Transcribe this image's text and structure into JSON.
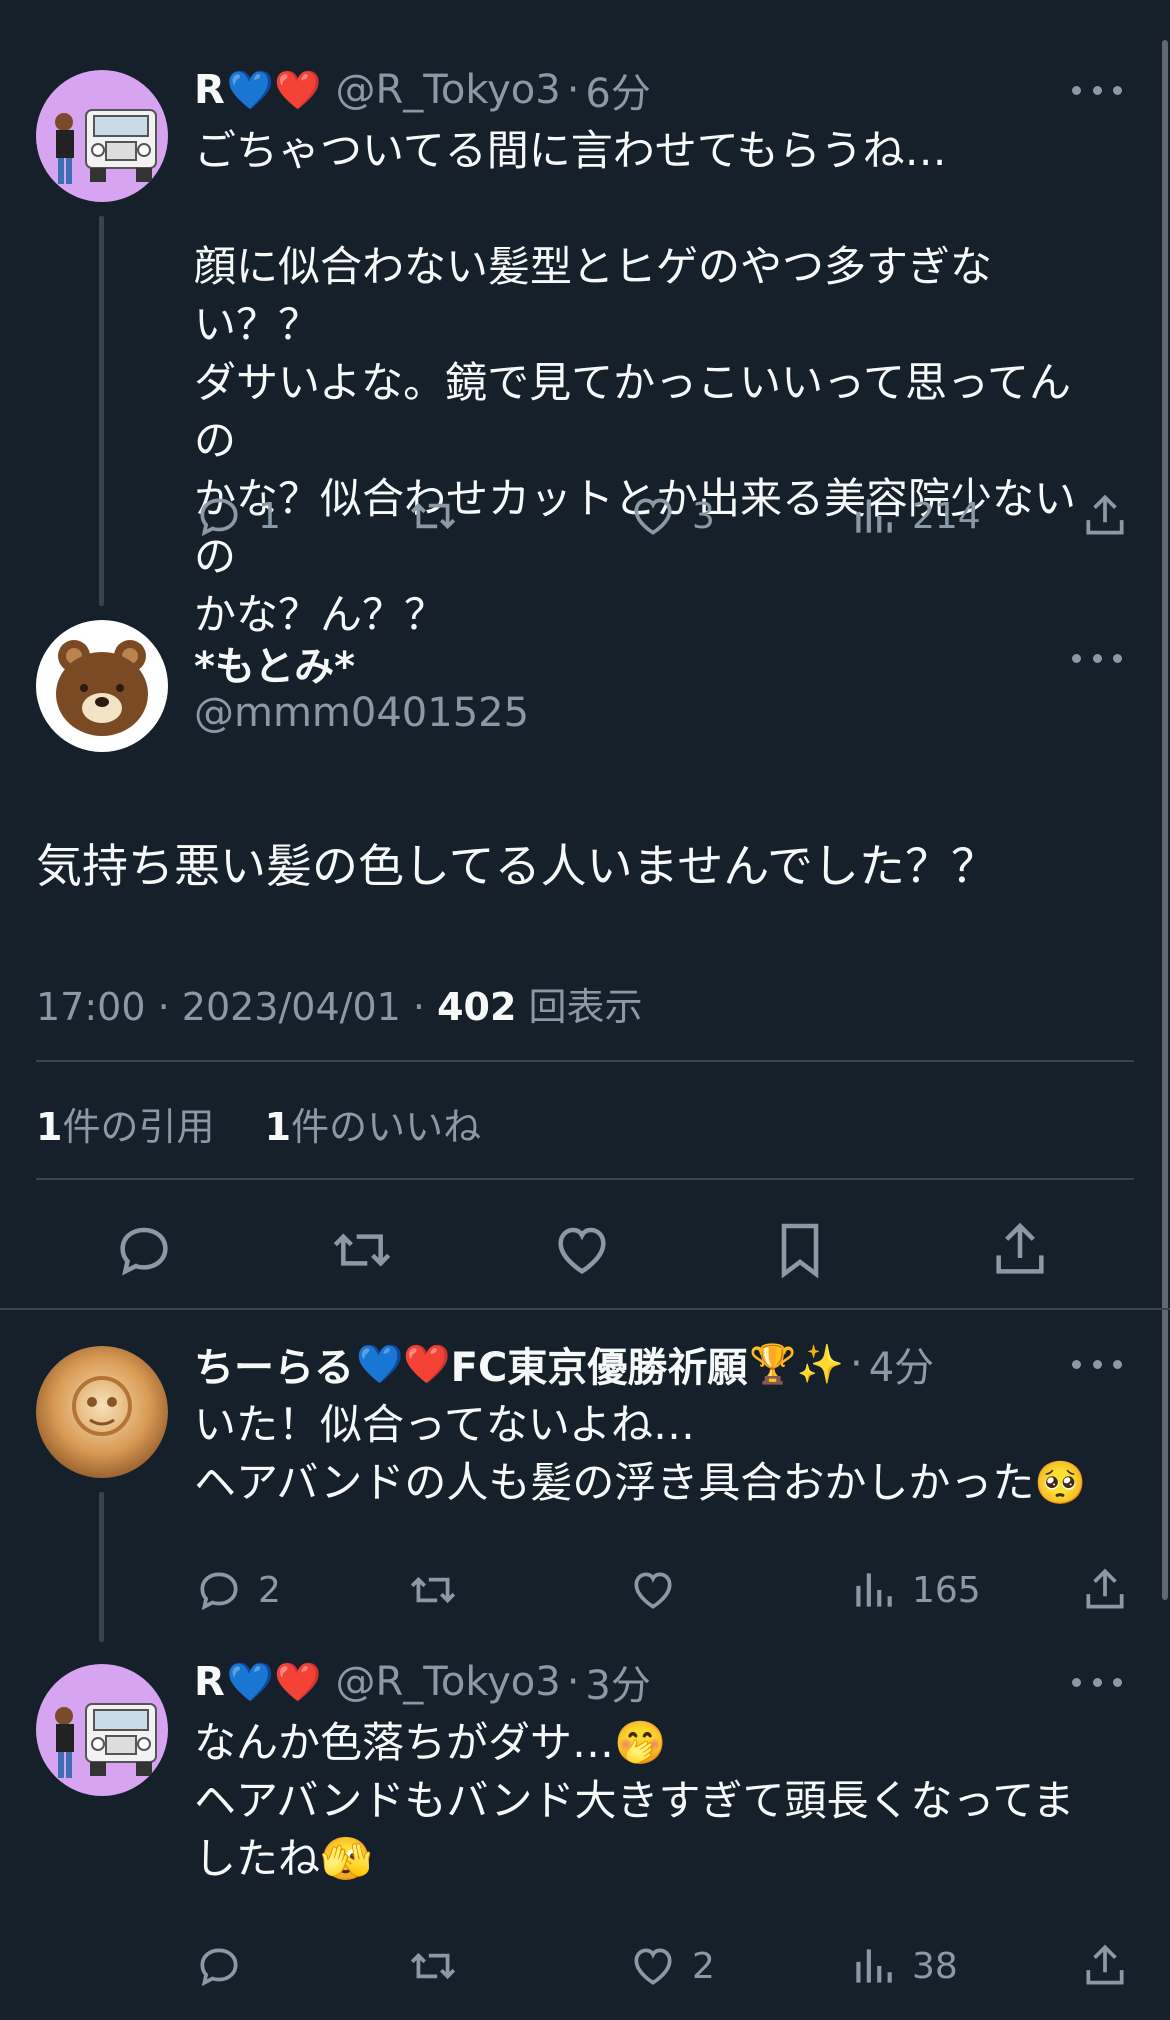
{
  "posts": [
    {
      "name": "R",
      "emoji": "💙❤️",
      "handle": "@R_Tokyo3",
      "time": "6分",
      "text": "ごちゃついてる間に言わせてもらうね…\n\n顔に似合わない髪型とヒゲのやつ多すぎない？？\nダサいよな。鏡で見てかっこいいって思ってんの\nかな？似合わせカットとか出来る美容院少ないの\nかな？ん？？",
      "reply_count": "1",
      "retweet_count": "",
      "like_count": "3",
      "view_count": "214"
    }
  ],
  "main_post": {
    "name": "*もとみ*",
    "handle": "@mmm0401525",
    "text": "気持ち悪い髪の色してる人いませんでした？？",
    "time": "17:00",
    "date": "2023/04/01",
    "views": "402",
    "views_label": "回表示",
    "quotes": "1",
    "quotes_label": "件の引用",
    "likes": "1",
    "likes_label": "件のいいね"
  },
  "replies": [
    {
      "name": "ちーらる",
      "emoji": "💙❤️",
      "name_suffix": "FC東京優勝祈願",
      "emoji2": "🏆✨",
      "time": "4分",
      "text": "いた！似合ってないよね…\nヘアバンドの人も髪の浮き具合おかしかった🥺",
      "reply_count": "2",
      "like_count": "",
      "view_count": "165"
    },
    {
      "name": "R",
      "emoji": "💙❤️",
      "handle": "@R_Tokyo3",
      "time": "3分",
      "text": "なんか色落ちがダサ…🤭\nヘアバンドもバンド大きすぎて頭長くなってま\nしたね🫣",
      "reply_count": "",
      "like_count": "2",
      "view_count": "38"
    }
  ],
  "colors": {
    "background": "#15202b",
    "secondary_text": "#8b98a5",
    "divider": "#38444d"
  }
}
